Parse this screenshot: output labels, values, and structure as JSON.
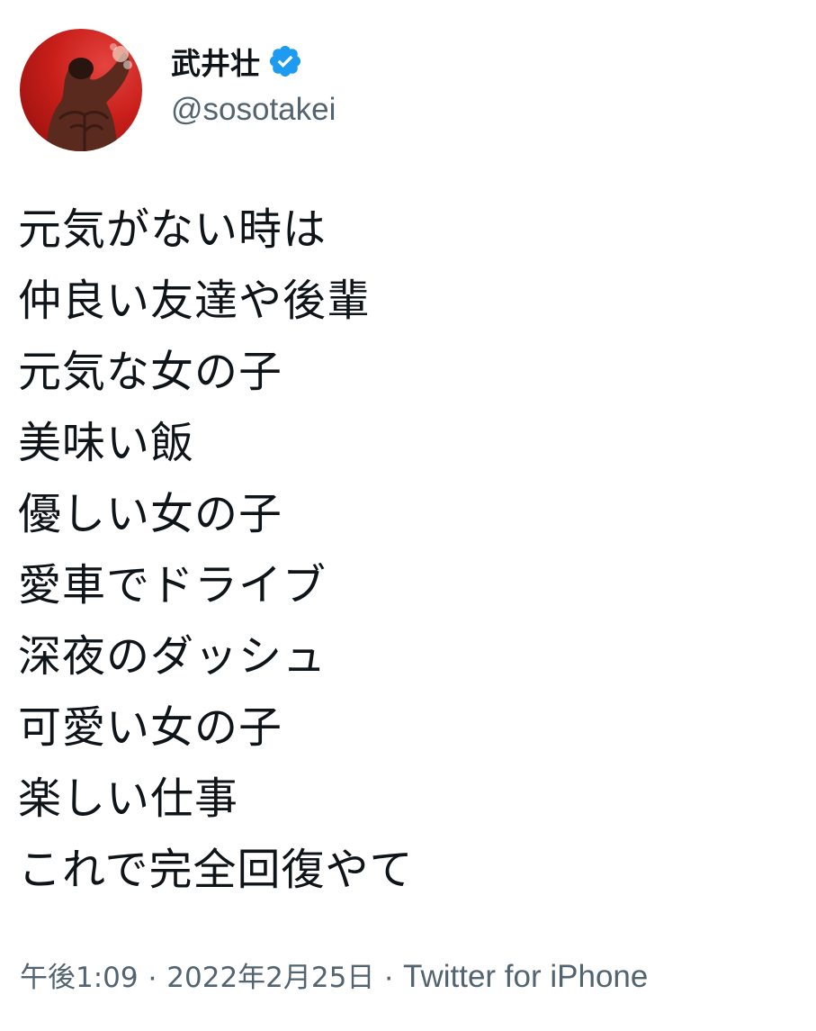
{
  "author": {
    "display_name": "武井壮",
    "handle": "@sosotakei",
    "verified": true,
    "avatar": "profile-photo"
  },
  "tweet": {
    "lines": [
      "元気がない時は",
      "仲良い友達や後輩",
      "元気な女の子",
      "美味い飯",
      "優しい女の子",
      "愛車でドライブ",
      "深夜のダッシュ",
      "可愛い女の子",
      "楽しい仕事",
      "これで完全回復やて"
    ]
  },
  "meta": {
    "time": "午後1:09",
    "separator": "·",
    "date": "2022年2月25日",
    "source": "Twitter for iPhone"
  },
  "colors": {
    "text": "#0f1419",
    "secondary": "#536471",
    "verified_badge": "#1d9bf0",
    "avatar_background": "#c81e1a"
  },
  "icons": {
    "verified": "verified-badge-icon"
  }
}
